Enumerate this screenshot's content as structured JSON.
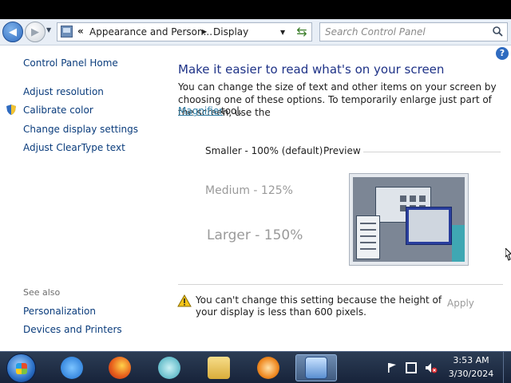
{
  "address_bar": {
    "chevrons": "«",
    "crumb1": "Appearance and Person...",
    "crumb2": "Display"
  },
  "search": {
    "placeholder": "Search Control Panel"
  },
  "sidebar": {
    "home": "Control Panel Home",
    "links": [
      "Adjust resolution",
      "Calibrate color",
      "Change display settings",
      "Adjust ClearType text"
    ],
    "see_also_label": "See also",
    "see_also_links": [
      "Personalization",
      "Devices and Printers"
    ]
  },
  "main": {
    "heading": "Make it easier to read what's on your screen",
    "description": "You can change the size of text and other items on your screen by choosing one of these options. To temporarily enlarge just part of the screen, use the",
    "magnifier_link": "Magnifier",
    "tool_word": "tool.",
    "options": [
      "Smaller - 100% (default)",
      "Medium - 125%",
      "Larger - 150%"
    ],
    "preview_label": "Preview",
    "warning": "You can't change this setting because the height of your display is less than 600 pixels.",
    "apply_label": "Apply"
  },
  "taskbar": {
    "clock_time": "3:53 AM",
    "clock_date": "3/30/2024",
    "apps": [
      "internet-explorer-icon",
      "firefox-icon",
      "media-app-icon",
      "folder-icon",
      "media-player-icon",
      "display-settings-icon"
    ]
  },
  "colors": {
    "link": "#0a3c7c",
    "heading": "#1e3287",
    "disabled": "#9a9a9a",
    "taskbar": "#17233a"
  }
}
